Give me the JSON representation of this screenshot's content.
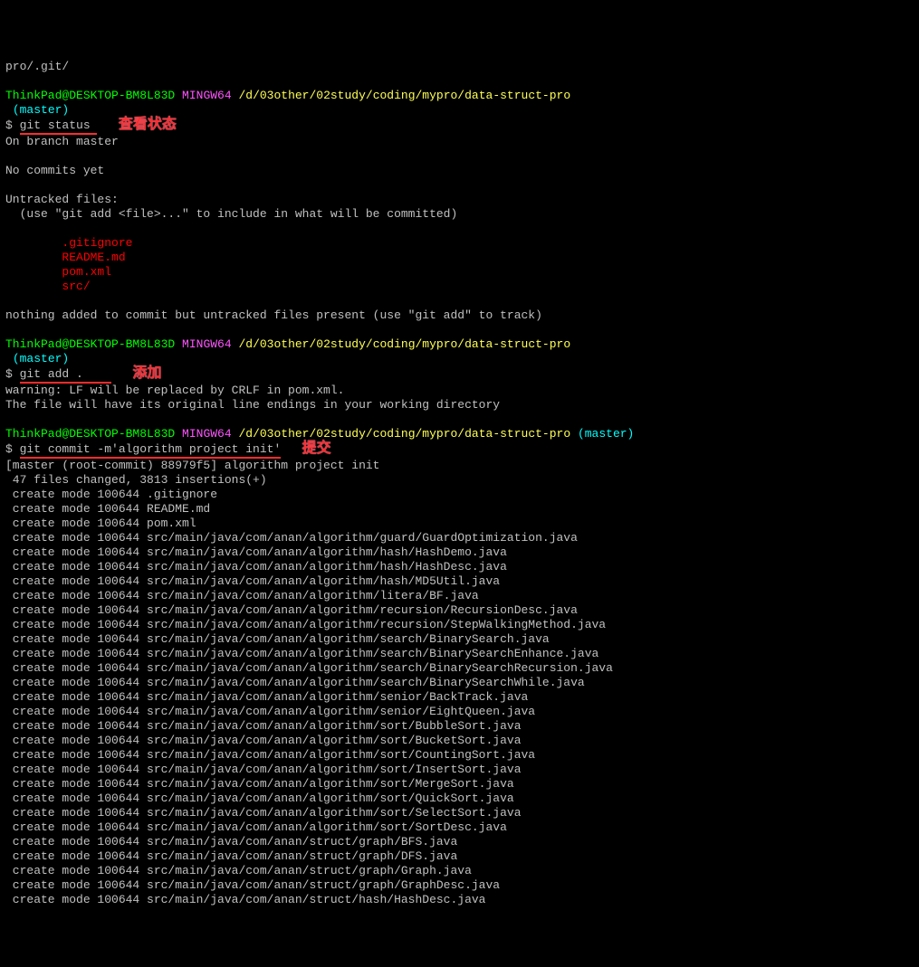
{
  "top_path": "pro/.git/",
  "prompt1": {
    "user_host": "ThinkPad@DESKTOP-BM8L83D",
    "shell": "MINGW64",
    "path": "/d/03other/02study/coding/mypro/data-struct-pro",
    "branch": "(master)",
    "dollar": "$ ",
    "cmd": "git status",
    "annot": "查看状态"
  },
  "status": {
    "on_branch": "On branch master",
    "no_commits": "No commits yet",
    "untracked_header": "Untracked files:",
    "use_add": "  (use \"git add <file>...\" to include in what will be committed)",
    "files": [
      ".gitignore",
      "README.md",
      "pom.xml",
      "src/"
    ],
    "nothing_added": "nothing added to commit but untracked files present (use \"git add\" to track)"
  },
  "prompt2": {
    "user_host": "ThinkPad@DESKTOP-BM8L83D",
    "shell": "MINGW64",
    "path": "/d/03other/02study/coding/mypro/data-struct-pro",
    "branch": "(master)",
    "dollar": "$ ",
    "cmd": "git add .",
    "annot": "添加"
  },
  "add_out": {
    "warn1": "warning: LF will be replaced by CRLF in pom.xml.",
    "warn2": "The file will have its original line endings in your working directory"
  },
  "prompt3": {
    "user_host": "ThinkPad@DESKTOP-BM8L83D",
    "shell": "MINGW64",
    "path": "/d/03other/02study/coding/mypro/data-struct-pro",
    "branch": "(master)",
    "dollar": "$ ",
    "cmd": "git commit -m'algorithm project init'",
    "annot": "提交"
  },
  "commit": {
    "result": "[master (root-commit) 88979f5] algorithm project init",
    "stats": " 47 files changed, 3813 insertions(+)",
    "created": [
      " create mode 100644 .gitignore",
      " create mode 100644 README.md",
      " create mode 100644 pom.xml",
      " create mode 100644 src/main/java/com/anan/algorithm/guard/GuardOptimization.java",
      " create mode 100644 src/main/java/com/anan/algorithm/hash/HashDemo.java",
      " create mode 100644 src/main/java/com/anan/algorithm/hash/HashDesc.java",
      " create mode 100644 src/main/java/com/anan/algorithm/hash/MD5Util.java",
      " create mode 100644 src/main/java/com/anan/algorithm/litera/BF.java",
      " create mode 100644 src/main/java/com/anan/algorithm/recursion/RecursionDesc.java",
      " create mode 100644 src/main/java/com/anan/algorithm/recursion/StepWalkingMethod.java",
      " create mode 100644 src/main/java/com/anan/algorithm/search/BinarySearch.java",
      " create mode 100644 src/main/java/com/anan/algorithm/search/BinarySearchEnhance.java",
      " create mode 100644 src/main/java/com/anan/algorithm/search/BinarySearchRecursion.java",
      " create mode 100644 src/main/java/com/anan/algorithm/search/BinarySearchWhile.java",
      " create mode 100644 src/main/java/com/anan/algorithm/senior/BackTrack.java",
      " create mode 100644 src/main/java/com/anan/algorithm/senior/EightQueen.java",
      " create mode 100644 src/main/java/com/anan/algorithm/sort/BubbleSort.java",
      " create mode 100644 src/main/java/com/anan/algorithm/sort/BucketSort.java",
      " create mode 100644 src/main/java/com/anan/algorithm/sort/CountingSort.java",
      " create mode 100644 src/main/java/com/anan/algorithm/sort/InsertSort.java",
      " create mode 100644 src/main/java/com/anan/algorithm/sort/MergeSort.java",
      " create mode 100644 src/main/java/com/anan/algorithm/sort/QuickSort.java",
      " create mode 100644 src/main/java/com/anan/algorithm/sort/SelectSort.java",
      " create mode 100644 src/main/java/com/anan/algorithm/sort/SortDesc.java",
      " create mode 100644 src/main/java/com/anan/struct/graph/BFS.java",
      " create mode 100644 src/main/java/com/anan/struct/graph/DFS.java",
      " create mode 100644 src/main/java/com/anan/struct/graph/Graph.java",
      " create mode 100644 src/main/java/com/anan/struct/graph/GraphDesc.java",
      " create mode 100644 src/main/java/com/anan/struct/hash/HashDesc.java"
    ]
  }
}
